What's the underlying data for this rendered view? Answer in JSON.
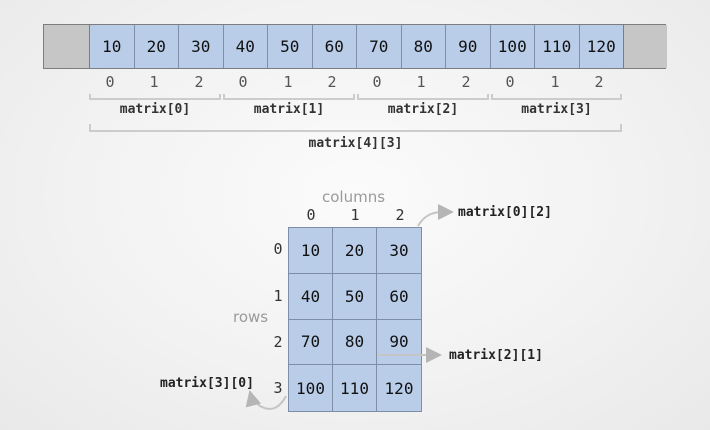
{
  "array": {
    "values": [
      "10",
      "20",
      "30",
      "40",
      "50",
      "60",
      "70",
      "80",
      "90",
      "100",
      "110",
      "120"
    ],
    "indices": [
      "0",
      "1",
      "2",
      "0",
      "1",
      "2",
      "0",
      "1",
      "2",
      "0",
      "1",
      "2"
    ],
    "groups": [
      "matrix[0]",
      "matrix[1]",
      "matrix[2]",
      "matrix[3]"
    ],
    "whole": "matrix[4][3]"
  },
  "grid": {
    "columns_label": "columns",
    "rows_label": "rows",
    "col_indices": [
      "0",
      "1",
      "2"
    ],
    "row_indices": [
      "0",
      "1",
      "2",
      "3"
    ],
    "cells": [
      [
        "10",
        "20",
        "30"
      ],
      [
        "40",
        "50",
        "60"
      ],
      [
        "70",
        "80",
        "90"
      ],
      [
        "100",
        "110",
        "120"
      ]
    ],
    "callouts": {
      "top_right": "matrix[0][2]",
      "middle_right": "matrix[2][1]",
      "bottom_left": "matrix[3][0]"
    }
  },
  "colors": {
    "cell_fill": "#b9cde9",
    "pad_fill": "#c6c6c6",
    "bracket": "#cccccc",
    "arrow": "#b5b5b5"
  }
}
